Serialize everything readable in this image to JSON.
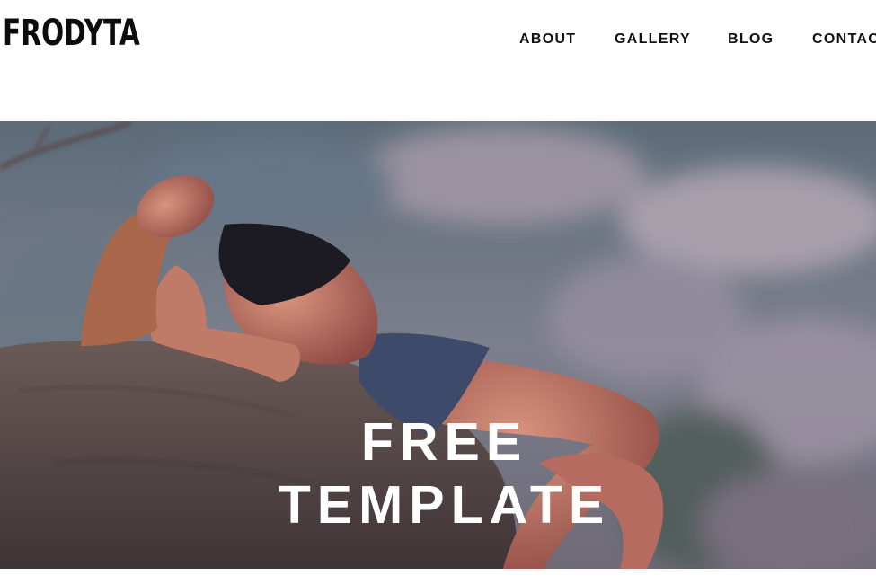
{
  "brand": {
    "logo_text": "FRODYTA"
  },
  "nav": {
    "items": [
      "ABOUT",
      "GALLERY",
      "BLOG",
      "CONTACT"
    ]
  },
  "hero": {
    "title_line1": "FREE",
    "title_line2": "TEMPLATE"
  },
  "colors": {
    "text": "#111111",
    "hero_text": "#ffffff",
    "background": "#ffffff"
  }
}
